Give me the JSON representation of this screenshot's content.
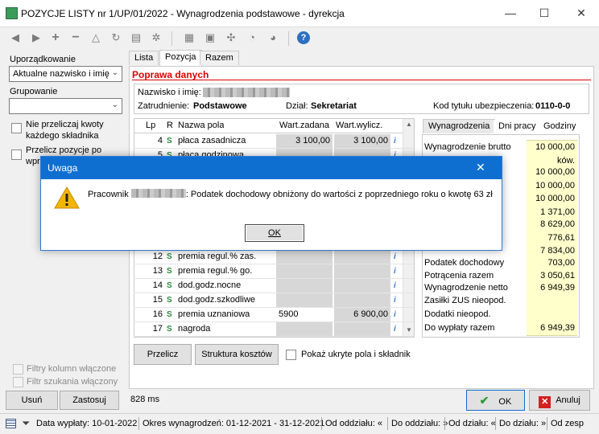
{
  "window": {
    "title": "POZYCJE LISTY nr 1/UP/01/2022 - Wynagrodzenia podstawowe - dyrekcja",
    "minimize": "—",
    "maximize": "☐",
    "close": "✕"
  },
  "toolbar": {
    "icons": [
      "nav-first-icon",
      "nav-next-icon",
      "add-icon",
      "remove-icon",
      "warning-icon",
      "refresh-icon",
      "print-icon",
      "settings-icon",
      "export-icon",
      "report-icon",
      "tools-icon",
      "sync-icon",
      "timer-icon",
      "help-icon"
    ],
    "help": "?"
  },
  "left": {
    "ordering_label": "Uporządkowanie",
    "ordering_value": "Aktualne nazwisko i imię",
    "grouping_label": "Grupowanie",
    "grouping_value": "",
    "chk1_label_l1": "Nie przeliczaj kwoty",
    "chk1_label_l2": "każdego składnika",
    "chk2_label_l1": "Przelicz pozycje po",
    "chk2_label_l2": "wpr",
    "filter_cols": "Filtry kolumn włączone",
    "filter_search": "Filtr szukania włączony",
    "remove_btn": "Usuń",
    "apply_btn": "Zastosuj"
  },
  "tabs": [
    "Lista",
    "Pozycja",
    "Razem"
  ],
  "active_tab": "Pozycja",
  "section_title": "Poprawa danych",
  "employee": {
    "name_label": "Nazwisko i imię:",
    "employment_label": "Zatrudnienie:",
    "employment_value": "Podstawowe",
    "dept_label": "Dział:",
    "dept_value": "Sekretariat",
    "ins_label": "Kod tytułu ubezpieczenia:",
    "ins_value": "0110-0-0"
  },
  "grid": {
    "headers": [
      "Lp",
      "R",
      "Nazwa pola",
      "Wart.zadana",
      "Wart.wylicz."
    ],
    "rows": [
      {
        "lp": "4",
        "name": "płaca zasadnicza",
        "set": "3 100,00",
        "calc": "3 100,00"
      },
      {
        "lp": "5",
        "name": "płaca godzinowa",
        "set": "",
        "calc": ""
      },
      {
        "lp": "12",
        "name": "premia regul.% zas.",
        "set": "",
        "calc": ""
      },
      {
        "lp": "13",
        "name": "premia regul.% go.",
        "set": "",
        "calc": ""
      },
      {
        "lp": "14",
        "name": "dod.godz.nocne",
        "set": "",
        "calc": ""
      },
      {
        "lp": "15",
        "name": "dod.godz.szkodliwe",
        "set": "",
        "calc": ""
      },
      {
        "lp": "16",
        "name": "premia uznaniowa",
        "set": "5900",
        "calc": "6 900,00"
      },
      {
        "lp": "17",
        "name": "nagroda",
        "set": "",
        "calc": ""
      }
    ]
  },
  "summary_tabs": [
    "Wynagrodzenia",
    "Dni pracy",
    "Godziny"
  ],
  "summary": [
    {
      "label": "Wynagrodzenie brutto",
      "value": "10 000,00"
    },
    {
      "label": "",
      "value": "ków."
    },
    {
      "label": "",
      "value": "10 000,00"
    },
    {
      "label": "",
      "value": "10 000,00"
    },
    {
      "label": "",
      "value": "10 000,00"
    },
    {
      "label": "",
      "value": "1 371,00"
    },
    {
      "label": "",
      "value": "8 629,00"
    },
    {
      "label": "",
      "value": "776,61"
    },
    {
      "label": "",
      "value": "7 834,00"
    },
    {
      "label": "Podatek dochodowy",
      "value": "703,00"
    },
    {
      "label": "Potrącenia razem",
      "value": "3 050,61"
    },
    {
      "label": "Wynagrodzenie netto",
      "value": "6 949,39"
    },
    {
      "label": "Zasiłki ZUS nieopod.",
      "value": ""
    },
    {
      "label": "Dodatki nieopod.",
      "value": ""
    },
    {
      "label": "Do wypłaty razem",
      "value": "6 949,39"
    }
  ],
  "bottom": {
    "recalc_btn": "Przelicz",
    "cost_btn": "Struktura kosztów",
    "hidden_chk": "Pokaż ukryte pola i składnik",
    "time": "828 ms",
    "ok_btn": "OK",
    "cancel_btn": "Anuluj"
  },
  "dialog": {
    "title": "Uwaga",
    "message_prefix": "Pracownik",
    "message_suffix": ": Podatek dochodowy obniżony do wartości z poprzedniego roku o kwotę 63 zł",
    "ok": "OK",
    "close": "✕"
  },
  "status": {
    "date": "Data wypłaty: 10-01-2022",
    "period": "Okres wynagrodzeń: 01-12-2021 - 31-12-2021",
    "from_dept1": "Od oddziału: «",
    "from_dept2": "Do oddziału: »",
    "from_div": "Od działu: «",
    "to_div": "Do działu: »",
    "from_team": "Od zesp"
  }
}
